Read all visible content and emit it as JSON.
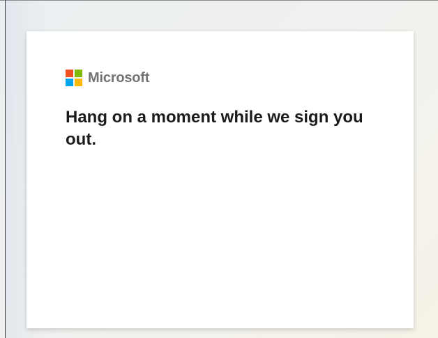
{
  "brand": {
    "name": "Microsoft",
    "logo_icon": "microsoft-logo-icon",
    "logo_colors": [
      "#f25022",
      "#7fba00",
      "#00a4ef",
      "#ffb900"
    ]
  },
  "message": {
    "title": "Hang on a moment while we sign you out."
  },
  "colors": {
    "card_background": "#ffffff",
    "title_text": "#1b1b1b",
    "brand_text": "#737373"
  }
}
